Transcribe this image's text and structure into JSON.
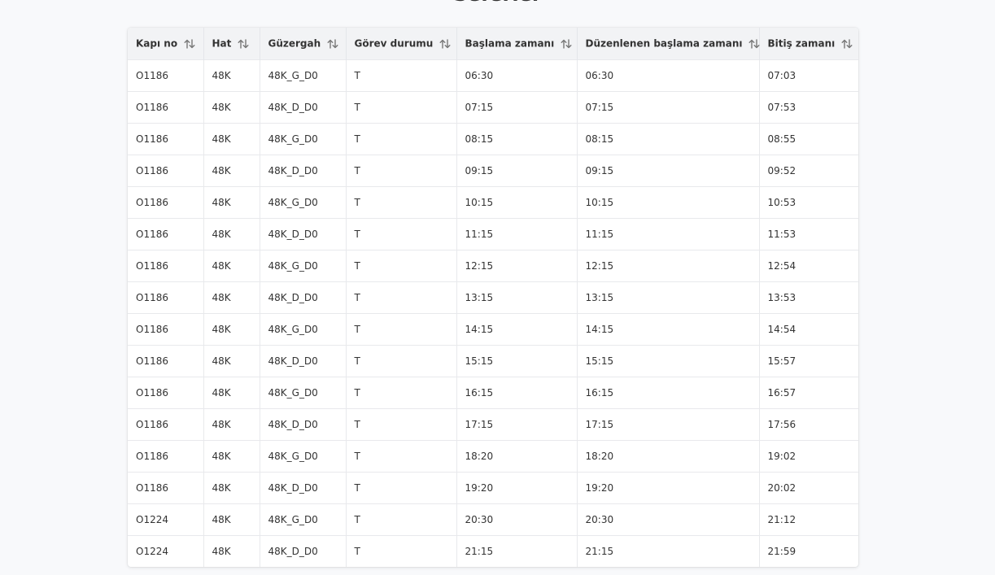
{
  "page": {
    "title": "Seferler"
  },
  "table": {
    "columns": [
      {
        "key": "kapi_no",
        "label": "Kapı no"
      },
      {
        "key": "hat",
        "label": "Hat"
      },
      {
        "key": "guzergah",
        "label": "Güzergah"
      },
      {
        "key": "gorev_durumu",
        "label": "Görev durumu"
      },
      {
        "key": "baslama",
        "label": "Başlama zamanı"
      },
      {
        "key": "duzenlenen",
        "label": "Düzenlenen başlama zamanı"
      },
      {
        "key": "bitis",
        "label": "Bitiş zamanı"
      }
    ],
    "rows": [
      [
        "O1186",
        "48K",
        "48K_G_D0",
        "T",
        "06:30",
        "06:30",
        "07:03"
      ],
      [
        "O1186",
        "48K",
        "48K_D_D0",
        "T",
        "07:15",
        "07:15",
        "07:53"
      ],
      [
        "O1186",
        "48K",
        "48K_G_D0",
        "T",
        "08:15",
        "08:15",
        "08:55"
      ],
      [
        "O1186",
        "48K",
        "48K_D_D0",
        "T",
        "09:15",
        "09:15",
        "09:52"
      ],
      [
        "O1186",
        "48K",
        "48K_G_D0",
        "T",
        "10:15",
        "10:15",
        "10:53"
      ],
      [
        "O1186",
        "48K",
        "48K_D_D0",
        "T",
        "11:15",
        "11:15",
        "11:53"
      ],
      [
        "O1186",
        "48K",
        "48K_G_D0",
        "T",
        "12:15",
        "12:15",
        "12:54"
      ],
      [
        "O1186",
        "48K",
        "48K_D_D0",
        "T",
        "13:15",
        "13:15",
        "13:53"
      ],
      [
        "O1186",
        "48K",
        "48K_G_D0",
        "T",
        "14:15",
        "14:15",
        "14:54"
      ],
      [
        "O1186",
        "48K",
        "48K_D_D0",
        "T",
        "15:15",
        "15:15",
        "15:57"
      ],
      [
        "O1186",
        "48K",
        "48K_G_D0",
        "T",
        "16:15",
        "16:15",
        "16:57"
      ],
      [
        "O1186",
        "48K",
        "48K_D_D0",
        "T",
        "17:15",
        "17:15",
        "17:56"
      ],
      [
        "O1186",
        "48K",
        "48K_G_D0",
        "T",
        "18:20",
        "18:20",
        "19:02"
      ],
      [
        "O1186",
        "48K",
        "48K_D_D0",
        "T",
        "19:20",
        "19:20",
        "20:02"
      ],
      [
        "O1224",
        "48K",
        "48K_G_D0",
        "T",
        "20:30",
        "20:30",
        "21:12"
      ],
      [
        "O1224",
        "48K",
        "48K_D_D0",
        "T",
        "21:15",
        "21:15",
        "21:59"
      ]
    ]
  },
  "icons": {
    "sort": "sort-arrows-icon"
  }
}
